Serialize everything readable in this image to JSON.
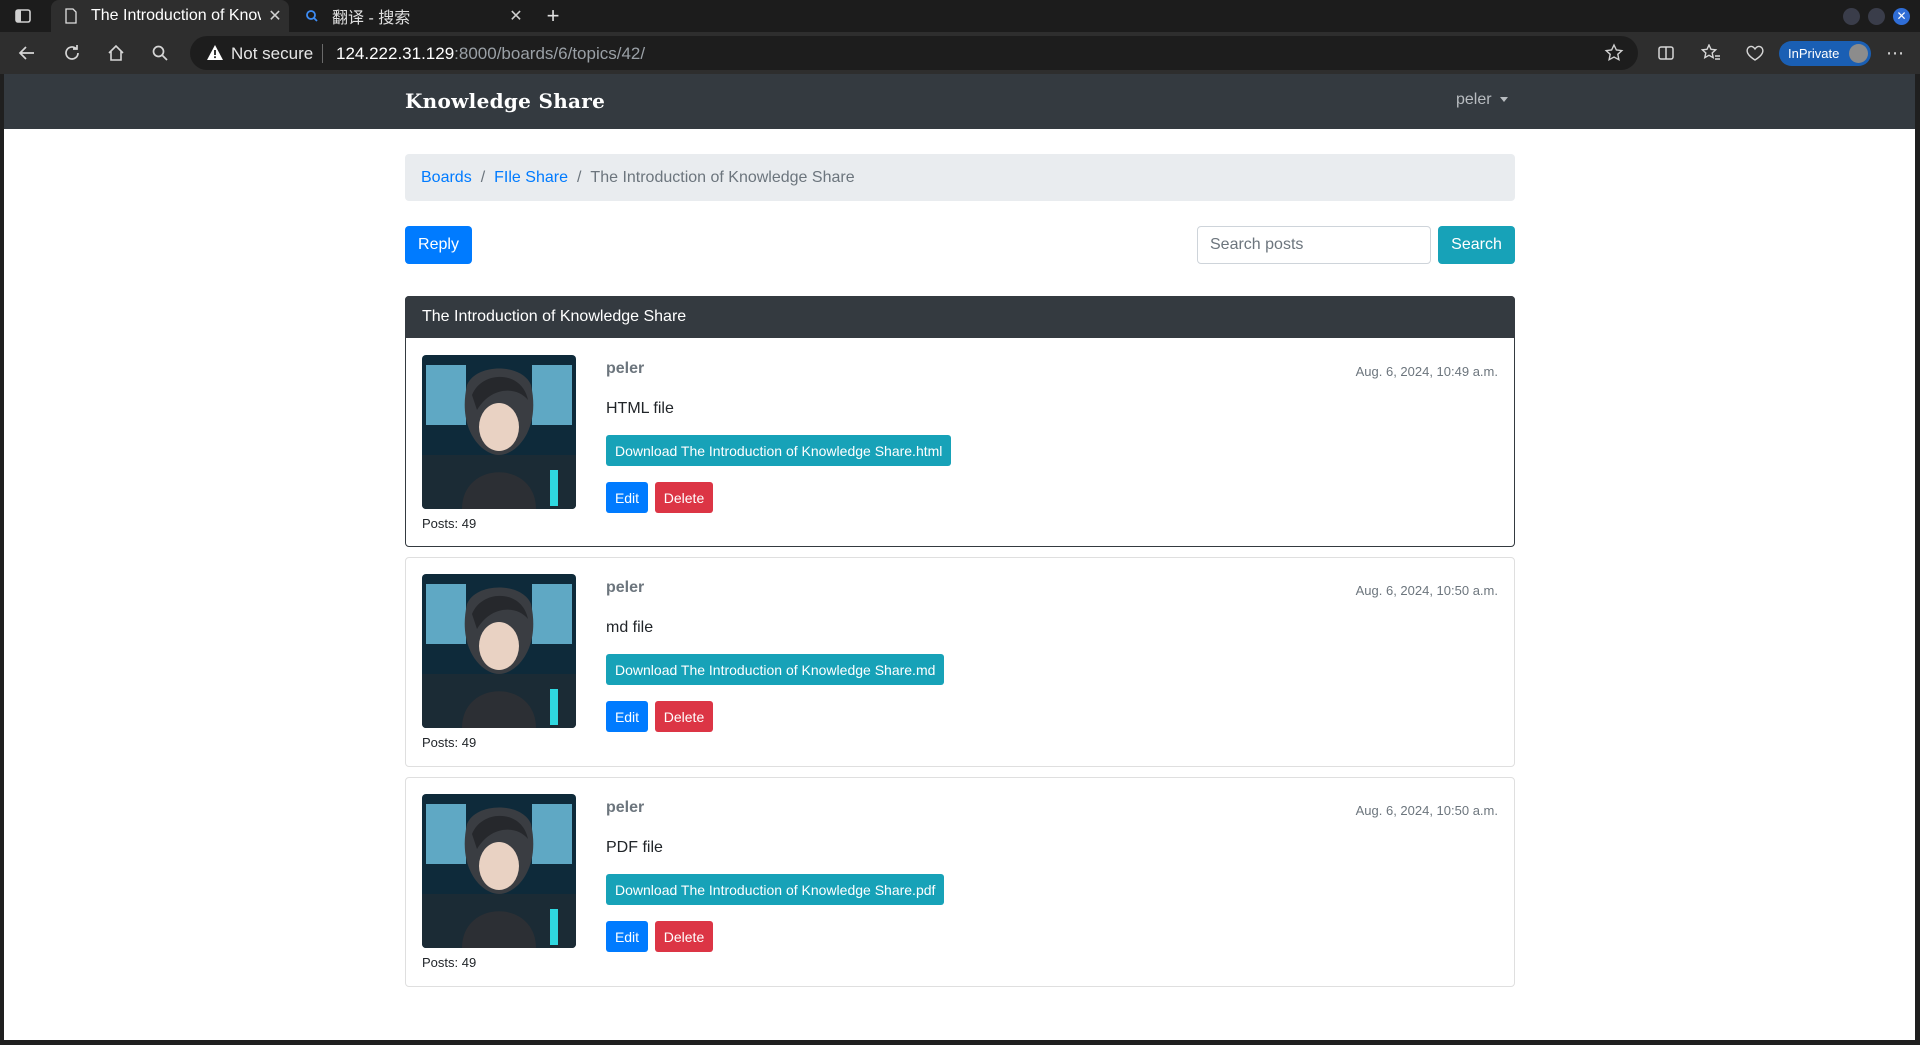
{
  "browser": {
    "tabs": [
      {
        "title": "The Introduction of Knowl",
        "active": true
      },
      {
        "title": "翻译 - 搜索",
        "active": false
      }
    ],
    "security_label": "Not secure",
    "url_host": "124.222.31.129",
    "url_rest": ":8000/boards/6/topics/42/",
    "inprivate_label": "InPrivate"
  },
  "navbar": {
    "brand": "Knowledge Share",
    "user": "peler"
  },
  "breadcrumb": {
    "items": [
      "Boards",
      "FIle Share"
    ],
    "current": "The Introduction of Knowledge Share"
  },
  "actions": {
    "reply_label": "Reply",
    "search_placeholder": "Search posts",
    "search_label": "Search"
  },
  "topic": {
    "title": "The Introduction of Knowledge Share"
  },
  "posts": [
    {
      "author": "peler",
      "date": "Aug. 6, 2024, 10:49 a.m.",
      "message": "HTML file",
      "download_label": "Download The Introduction of Knowledge Share.html",
      "posts_count": "Posts: 49",
      "edit_label": "Edit",
      "delete_label": "Delete"
    },
    {
      "author": "peler",
      "date": "Aug. 6, 2024, 10:50 a.m.",
      "message": "md file",
      "download_label": "Download The Introduction of Knowledge Share.md",
      "posts_count": "Posts: 49",
      "edit_label": "Edit",
      "delete_label": "Delete"
    },
    {
      "author": "peler",
      "date": "Aug. 6, 2024, 10:50 a.m.",
      "message": "PDF file",
      "download_label": "Download The Introduction of Knowledge Share.pdf",
      "posts_count": "Posts: 49",
      "edit_label": "Edit",
      "delete_label": "Delete"
    }
  ],
  "colors": {
    "navbar": "#343a40",
    "primary": "#007bff",
    "info": "#17a2b8",
    "danger": "#dc3545",
    "breadcrumb_bg": "#e9ecef"
  }
}
